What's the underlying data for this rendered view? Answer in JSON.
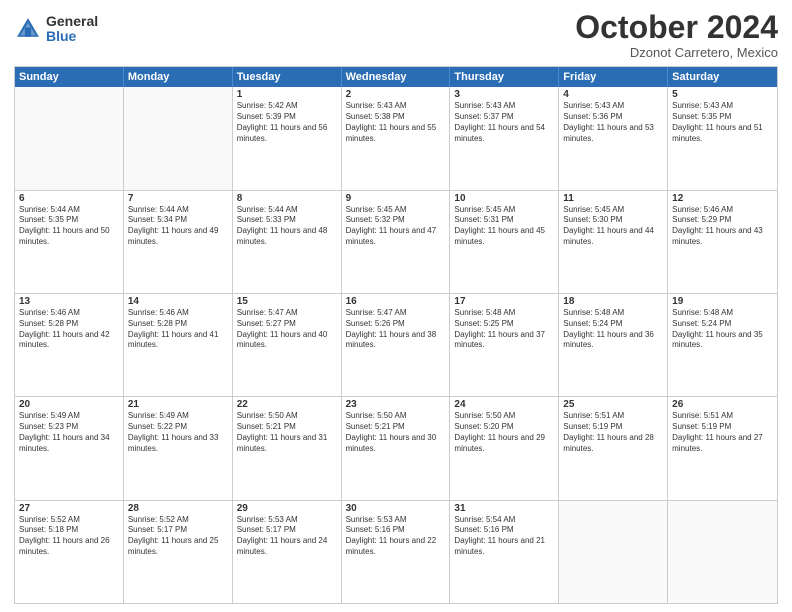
{
  "header": {
    "logo_general": "General",
    "logo_blue": "Blue",
    "month_title": "October 2024",
    "subtitle": "Dzonot Carretero, Mexico"
  },
  "weekdays": [
    "Sunday",
    "Monday",
    "Tuesday",
    "Wednesday",
    "Thursday",
    "Friday",
    "Saturday"
  ],
  "rows": [
    [
      {
        "day": "",
        "info": "",
        "empty": true
      },
      {
        "day": "",
        "info": "",
        "empty": true
      },
      {
        "day": "1",
        "info": "Sunrise: 5:42 AM\nSunset: 5:39 PM\nDaylight: 11 hours and 56 minutes."
      },
      {
        "day": "2",
        "info": "Sunrise: 5:43 AM\nSunset: 5:38 PM\nDaylight: 11 hours and 55 minutes."
      },
      {
        "day": "3",
        "info": "Sunrise: 5:43 AM\nSunset: 5:37 PM\nDaylight: 11 hours and 54 minutes."
      },
      {
        "day": "4",
        "info": "Sunrise: 5:43 AM\nSunset: 5:36 PM\nDaylight: 11 hours and 53 minutes."
      },
      {
        "day": "5",
        "info": "Sunrise: 5:43 AM\nSunset: 5:35 PM\nDaylight: 11 hours and 51 minutes."
      }
    ],
    [
      {
        "day": "6",
        "info": "Sunrise: 5:44 AM\nSunset: 5:35 PM\nDaylight: 11 hours and 50 minutes."
      },
      {
        "day": "7",
        "info": "Sunrise: 5:44 AM\nSunset: 5:34 PM\nDaylight: 11 hours and 49 minutes."
      },
      {
        "day": "8",
        "info": "Sunrise: 5:44 AM\nSunset: 5:33 PM\nDaylight: 11 hours and 48 minutes."
      },
      {
        "day": "9",
        "info": "Sunrise: 5:45 AM\nSunset: 5:32 PM\nDaylight: 11 hours and 47 minutes."
      },
      {
        "day": "10",
        "info": "Sunrise: 5:45 AM\nSunset: 5:31 PM\nDaylight: 11 hours and 45 minutes."
      },
      {
        "day": "11",
        "info": "Sunrise: 5:45 AM\nSunset: 5:30 PM\nDaylight: 11 hours and 44 minutes."
      },
      {
        "day": "12",
        "info": "Sunrise: 5:46 AM\nSunset: 5:29 PM\nDaylight: 11 hours and 43 minutes."
      }
    ],
    [
      {
        "day": "13",
        "info": "Sunrise: 5:46 AM\nSunset: 5:28 PM\nDaylight: 11 hours and 42 minutes."
      },
      {
        "day": "14",
        "info": "Sunrise: 5:46 AM\nSunset: 5:28 PM\nDaylight: 11 hours and 41 minutes."
      },
      {
        "day": "15",
        "info": "Sunrise: 5:47 AM\nSunset: 5:27 PM\nDaylight: 11 hours and 40 minutes."
      },
      {
        "day": "16",
        "info": "Sunrise: 5:47 AM\nSunset: 5:26 PM\nDaylight: 11 hours and 38 minutes."
      },
      {
        "day": "17",
        "info": "Sunrise: 5:48 AM\nSunset: 5:25 PM\nDaylight: 11 hours and 37 minutes."
      },
      {
        "day": "18",
        "info": "Sunrise: 5:48 AM\nSunset: 5:24 PM\nDaylight: 11 hours and 36 minutes."
      },
      {
        "day": "19",
        "info": "Sunrise: 5:48 AM\nSunset: 5:24 PM\nDaylight: 11 hours and 35 minutes."
      }
    ],
    [
      {
        "day": "20",
        "info": "Sunrise: 5:49 AM\nSunset: 5:23 PM\nDaylight: 11 hours and 34 minutes."
      },
      {
        "day": "21",
        "info": "Sunrise: 5:49 AM\nSunset: 5:22 PM\nDaylight: 11 hours and 33 minutes."
      },
      {
        "day": "22",
        "info": "Sunrise: 5:50 AM\nSunset: 5:21 PM\nDaylight: 11 hours and 31 minutes."
      },
      {
        "day": "23",
        "info": "Sunrise: 5:50 AM\nSunset: 5:21 PM\nDaylight: 11 hours and 30 minutes."
      },
      {
        "day": "24",
        "info": "Sunrise: 5:50 AM\nSunset: 5:20 PM\nDaylight: 11 hours and 29 minutes."
      },
      {
        "day": "25",
        "info": "Sunrise: 5:51 AM\nSunset: 5:19 PM\nDaylight: 11 hours and 28 minutes."
      },
      {
        "day": "26",
        "info": "Sunrise: 5:51 AM\nSunset: 5:19 PM\nDaylight: 11 hours and 27 minutes."
      }
    ],
    [
      {
        "day": "27",
        "info": "Sunrise: 5:52 AM\nSunset: 5:18 PM\nDaylight: 11 hours and 26 minutes."
      },
      {
        "day": "28",
        "info": "Sunrise: 5:52 AM\nSunset: 5:17 PM\nDaylight: 11 hours and 25 minutes."
      },
      {
        "day": "29",
        "info": "Sunrise: 5:53 AM\nSunset: 5:17 PM\nDaylight: 11 hours and 24 minutes."
      },
      {
        "day": "30",
        "info": "Sunrise: 5:53 AM\nSunset: 5:16 PM\nDaylight: 11 hours and 22 minutes."
      },
      {
        "day": "31",
        "info": "Sunrise: 5:54 AM\nSunset: 5:16 PM\nDaylight: 11 hours and 21 minutes."
      },
      {
        "day": "",
        "info": "",
        "empty": true
      },
      {
        "day": "",
        "info": "",
        "empty": true
      }
    ]
  ]
}
